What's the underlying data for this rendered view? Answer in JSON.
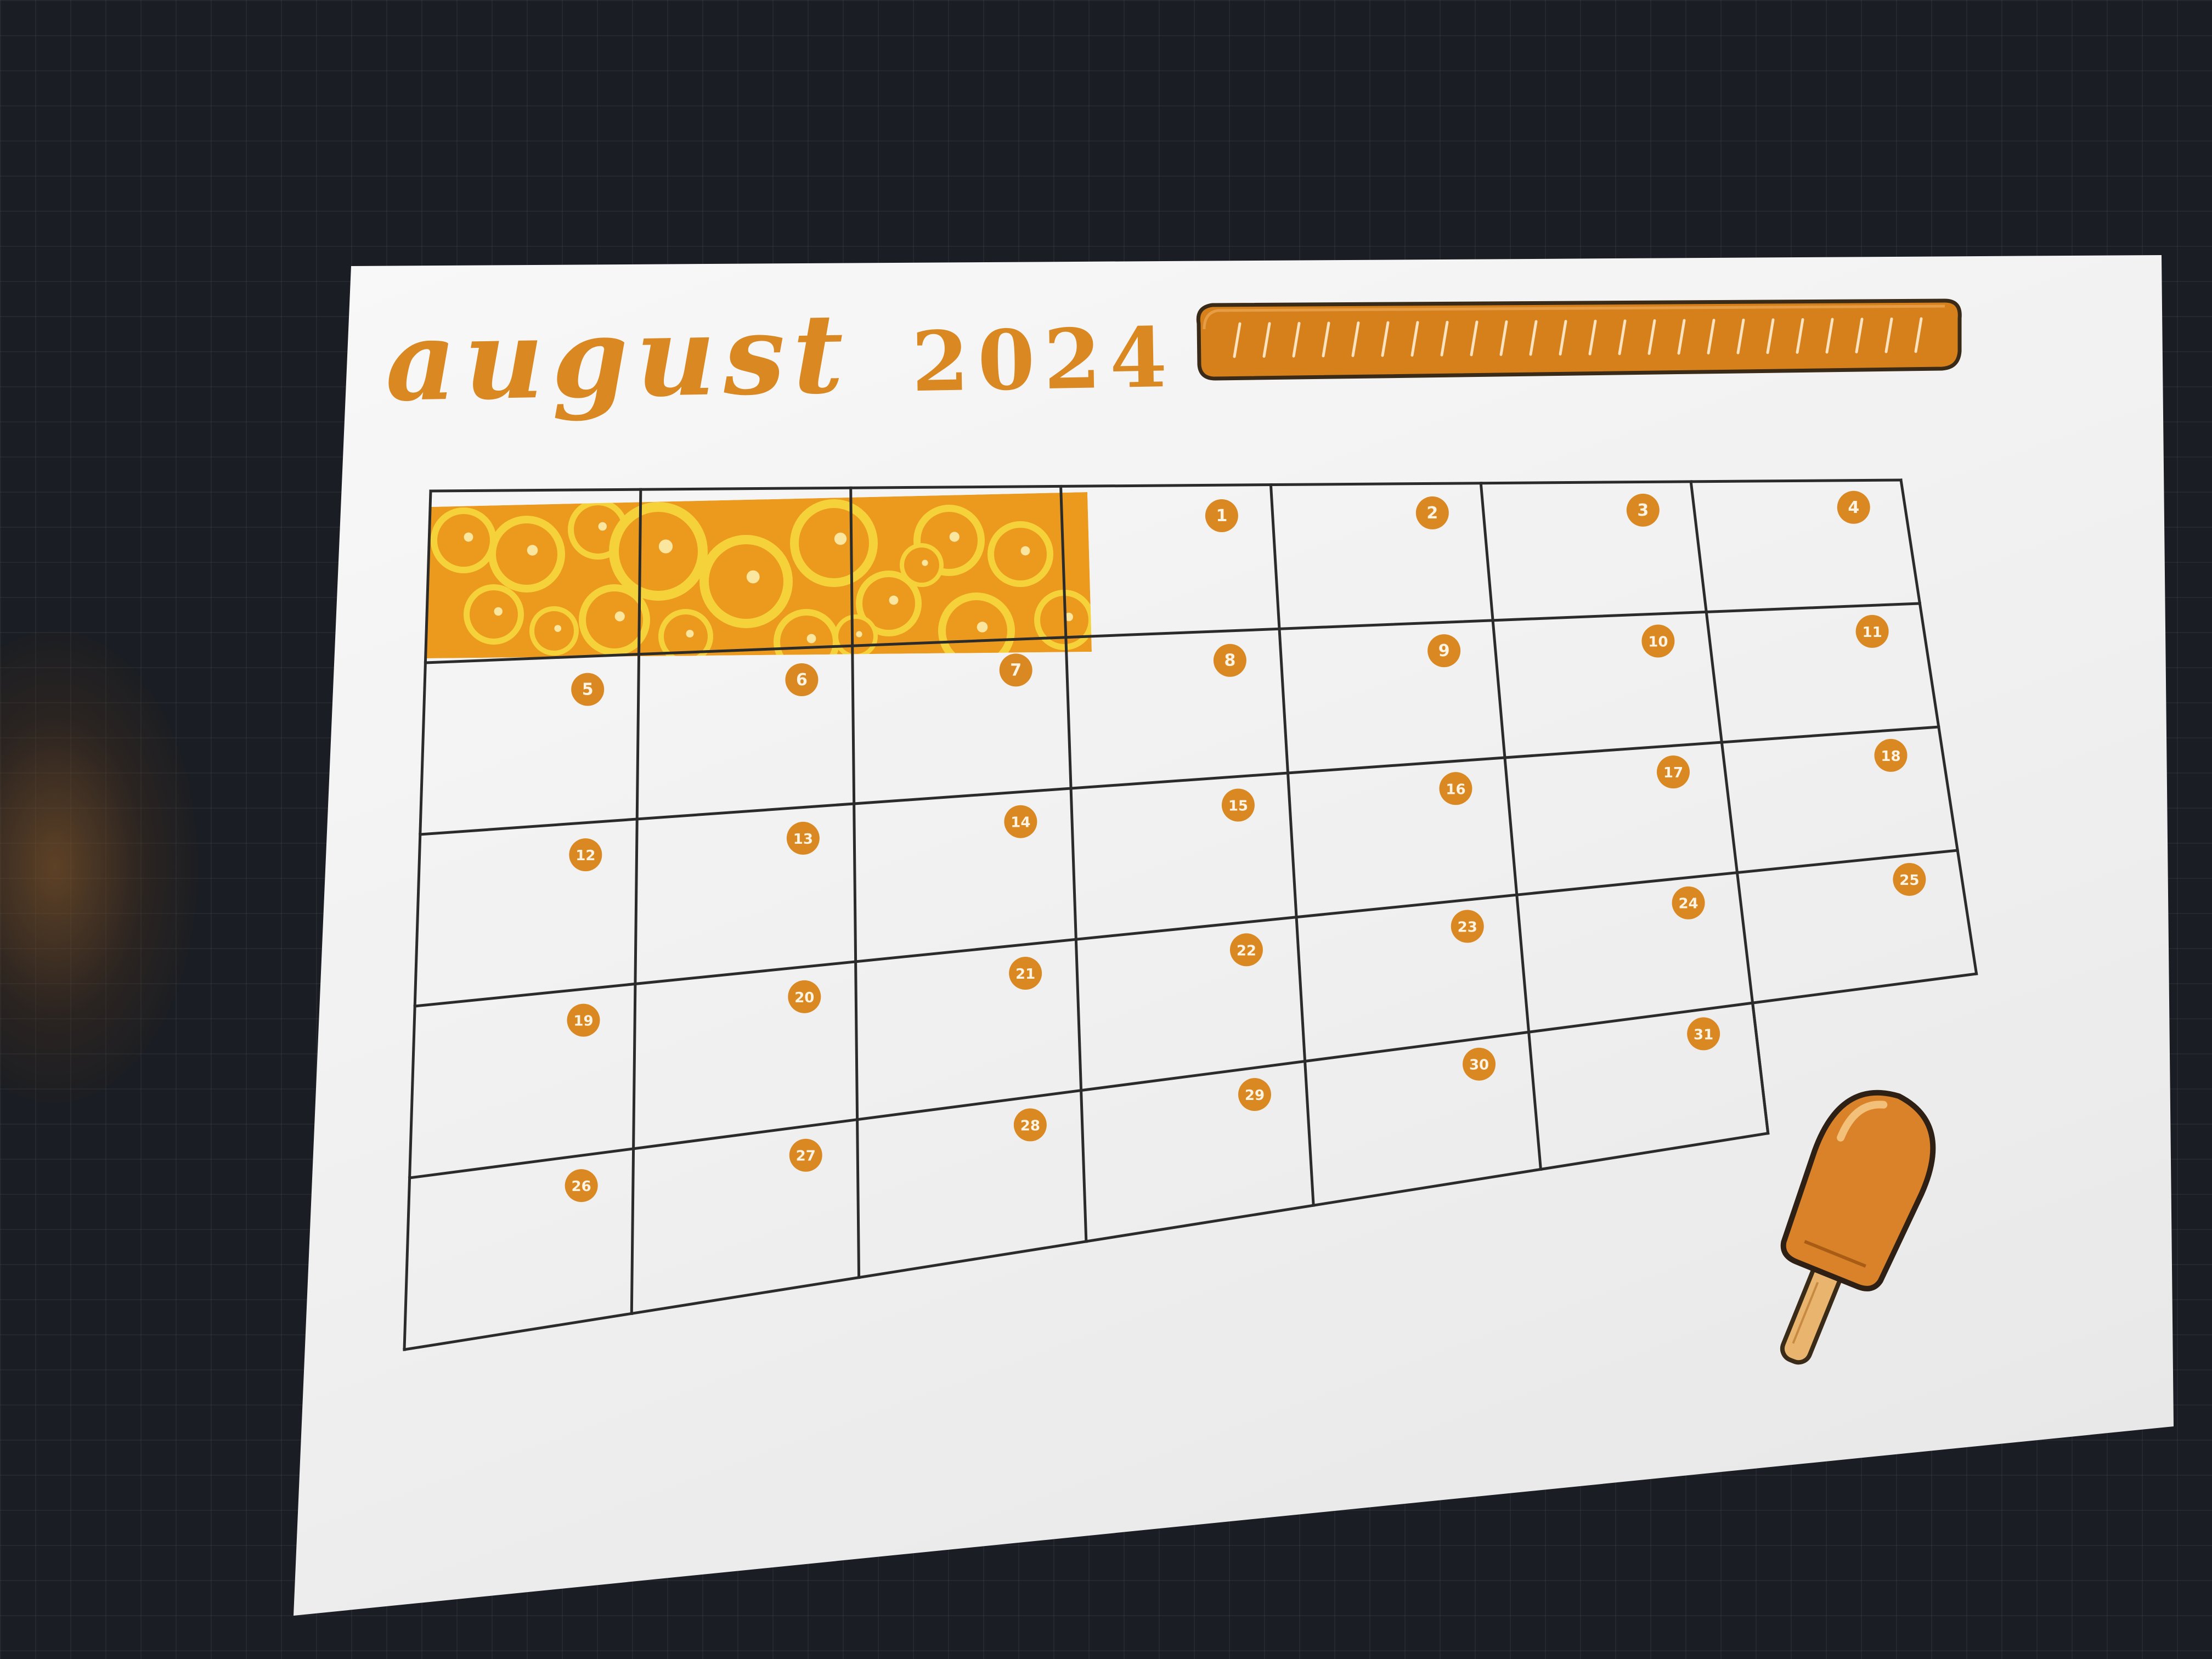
{
  "title": {
    "month": "august",
    "year": "2024"
  },
  "calendar": {
    "weeks": [
      [
        "",
        "",
        "",
        "1",
        "2",
        "3",
        "4"
      ],
      [
        "5",
        "6",
        "7",
        "8",
        "9",
        "10",
        "11"
      ],
      [
        "12",
        "13",
        "14",
        "15",
        "16",
        "17",
        "18"
      ],
      [
        "19",
        "20",
        "21",
        "22",
        "23",
        "24",
        "25"
      ],
      [
        "26",
        "27",
        "28",
        "29",
        "30",
        "31"
      ]
    ]
  },
  "colors": {
    "accent": "#d98822",
    "accent_dark": "#c26f12",
    "pattern_light": "#f6d23a",
    "pattern_bg": "#ec9a1e",
    "grid_line": "#2b2b2b",
    "paper": "#f7f7f7"
  },
  "decorations": {
    "top_banner": "striped-banner-decoration",
    "corner_sticker": "popsicle-icon",
    "blank_cells_fill": "orange-slices-pattern"
  }
}
